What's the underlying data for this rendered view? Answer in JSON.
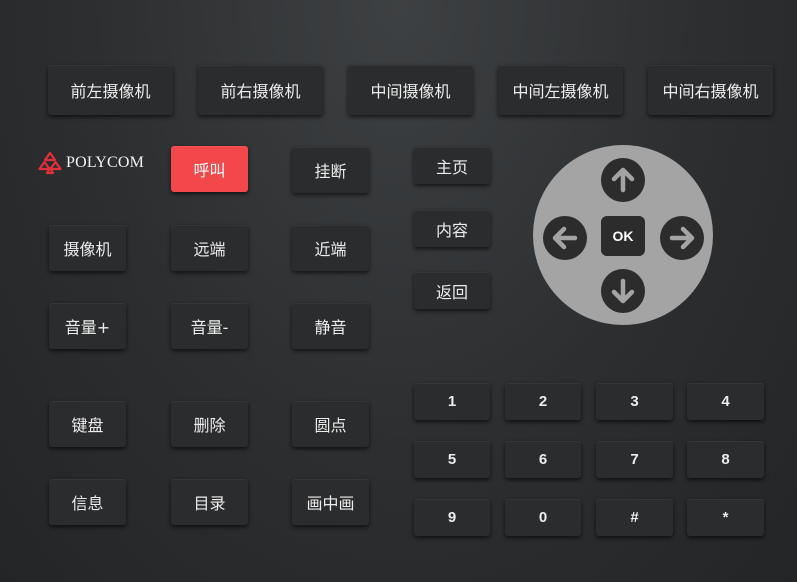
{
  "cameras": [
    "前左摄像机",
    "前右摄像机",
    "中间摄像机",
    "中间左摄像机",
    "中间右摄像机"
  ],
  "logo": {
    "text": "POLYCOM",
    "color": "#e2303a"
  },
  "call": {
    "call": "呼叫",
    "hangup": "挂断",
    "call_color": "#f2484c"
  },
  "controls": {
    "camera": "摄像机",
    "far": "远端",
    "near": "近端",
    "vol_up": "音量+",
    "vol_down": "音量-",
    "mute": "静音",
    "keyboard": "键盘",
    "delete": "删除",
    "dot": "圆点",
    "info": "信息",
    "directory": "目录",
    "pip": "画中画"
  },
  "nav": {
    "home": "主页",
    "content": "内容",
    "back": "返回"
  },
  "dpad": {
    "ok": "OK"
  },
  "keypad": [
    "1",
    "2",
    "3",
    "4",
    "5",
    "6",
    "7",
    "8",
    "9",
    "0",
    "#",
    "*"
  ]
}
